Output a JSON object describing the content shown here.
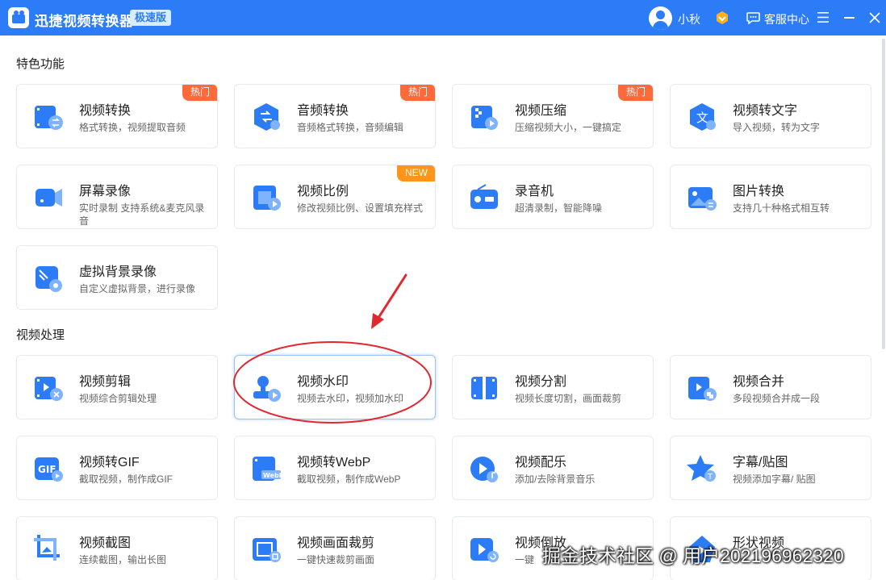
{
  "titlebar": {
    "app_title": "迅捷视频转换器",
    "edition_badge": "极速版",
    "username": "小秋",
    "service_label": "客服中心"
  },
  "sections": {
    "featured_title": "特色功能",
    "video_processing_title": "视频处理"
  },
  "featured": [
    {
      "title": "视频转换",
      "desc": "格式转换，视频提取音频",
      "tag": "热门",
      "icon": "video-convert-icon"
    },
    {
      "title": "音频转换",
      "desc": "音频格式转换，音频编辑",
      "tag": "热门",
      "icon": "audio-convert-icon"
    },
    {
      "title": "视频压缩",
      "desc": "压缩视频大小，一键搞定",
      "tag": "热门",
      "icon": "video-compress-icon"
    },
    {
      "title": "视频转文字",
      "desc": "导入视频，转为文字",
      "icon": "video-to-text-icon"
    },
    {
      "title": "屏幕录像",
      "desc": "实时录制 支持系统&麦克风录音",
      "icon": "screen-record-icon"
    },
    {
      "title": "视频比例",
      "desc": "修改视频比例、设置填充样式",
      "tag": "NEW",
      "icon": "video-ratio-icon"
    },
    {
      "title": "录音机",
      "desc": "超清录制，智能降噪",
      "icon": "recorder-icon"
    },
    {
      "title": "图片转换",
      "desc": "支持几十种格式相互转",
      "icon": "image-convert-icon"
    },
    {
      "title": "虚拟背景录像",
      "desc": "自定义虚拟背景，进行录像",
      "icon": "virtual-background-icon"
    }
  ],
  "processing": [
    {
      "title": "视频剪辑",
      "desc": "视频综合剪辑处理",
      "icon": "video-edit-icon"
    },
    {
      "title": "视频水印",
      "desc": "视频去水印，视频加水印",
      "icon": "video-watermark-icon"
    },
    {
      "title": "视频分割",
      "desc": "视频长度切割，画面裁剪",
      "icon": "video-split-icon"
    },
    {
      "title": "视频合并",
      "desc": "多段视频合并成一段",
      "icon": "video-merge-icon"
    },
    {
      "title": "视频转GIF",
      "desc": "截取视频，制作成GIF",
      "icon": "video-to-gif-icon"
    },
    {
      "title": "视频转WebP",
      "desc": "截取视频，制作成WebP",
      "icon": "video-to-webp-icon"
    },
    {
      "title": "视频配乐",
      "desc": "添加/去除背景音乐",
      "icon": "video-music-icon"
    },
    {
      "title": "字幕/贴图",
      "desc": "视频添加字幕/ 贴图",
      "icon": "subtitle-sticker-icon"
    },
    {
      "title": "视频截图",
      "desc": "连续截图，输出长图",
      "icon": "video-screenshot-icon"
    },
    {
      "title": "视频画面裁剪",
      "desc": "一键快速裁剪画面",
      "icon": "video-crop-icon"
    },
    {
      "title": "视频倒放",
      "desc": "一键",
      "icon": "video-reverse-icon"
    },
    {
      "title": "形状视频",
      "desc": "",
      "icon": "shape-video-icon"
    }
  ],
  "watermark_text": "掘金技术社区 @ 用户2021969623​20",
  "colors": {
    "accent": "#2b7cf6",
    "hot_tag": "#ff6a3d",
    "new_tag": "#ff9519",
    "annotation_red": "#e0282e"
  }
}
